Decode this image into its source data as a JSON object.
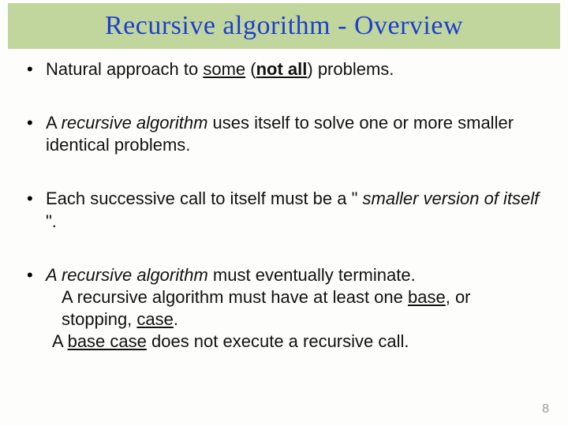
{
  "title": "Recursive algorithm  - Overview",
  "b1": {
    "t1": "Natural approach to ",
    "some": "some",
    "t2": " (",
    "notall": "not all",
    "t3": ") problems."
  },
  "b2": {
    "t1": "A ",
    "ra": "recursive algorithm",
    "t2": " uses itself to solve one or more smaller identical problems."
  },
  "b3": {
    "t1": "Each successive call to itself must be a \" ",
    "sv": "smaller version of itself",
    "t2": " \"."
  },
  "b4": {
    "l1a": "A recursive algorithm",
    "l1b": " must eventually terminate.",
    "l2a": "A recursive algorithm must have at least one ",
    "l2b": "base",
    "l2c": ", or stopping, ",
    "l2d": "case",
    "l2e": ".",
    "l3a": "A ",
    "l3b": "base case",
    "l3c": " does not execute a recursive call."
  },
  "page": "8"
}
